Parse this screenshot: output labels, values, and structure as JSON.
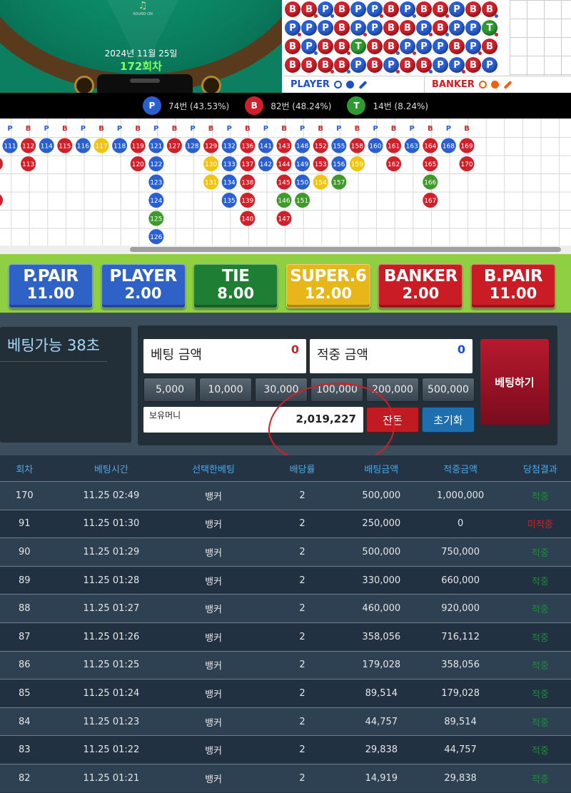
{
  "table": {
    "date": "2024년 11월 25일",
    "round": "172회차",
    "sound_label": "SOUND ON"
  },
  "bead_road": {
    "rows": [
      [
        "B",
        "B",
        "P",
        "B",
        "P",
        "P",
        "B",
        "P",
        "B",
        "B",
        "P",
        "B",
        "B"
      ],
      [
        "P",
        "P",
        "P",
        "B",
        "P",
        "P",
        "B",
        "B",
        "P",
        "B",
        "P",
        "P",
        "T"
      ],
      [
        "B",
        "P",
        "B",
        "B",
        "T",
        "B",
        "B",
        "P",
        "P",
        "P",
        "B",
        "P",
        "B"
      ],
      [
        "B",
        "B",
        "B",
        "B",
        "P",
        "B",
        "P",
        "B",
        "B",
        "P",
        "P",
        "B",
        "P"
      ]
    ]
  },
  "legend": {
    "player": "PLAYER",
    "banker": "BANKER"
  },
  "stats": [
    {
      "icon": "P",
      "text": "74번 (43.53%)",
      "color": "#2a5fd1"
    },
    {
      "icon": "B",
      "text": "82번 (48.24%)",
      "color": "#d0202a"
    },
    {
      "icon": "T",
      "text": "14번 (8.24%)",
      "color": "#2c9b30"
    }
  ],
  "big_road": {
    "headers": [
      "P",
      "B",
      "P",
      "B",
      "P",
      "B",
      "P",
      "B",
      "P",
      "B",
      "P",
      "B",
      "P",
      "B",
      "P",
      "B",
      "P",
      "B",
      "P",
      "B",
      "P",
      "B",
      "P",
      "B",
      "P",
      "B"
    ],
    "columns": [
      [
        [
          "111",
          "P"
        ]
      ],
      [
        [
          "112",
          "B"
        ],
        [
          "113",
          "B"
        ]
      ],
      [
        [
          "114",
          "P"
        ]
      ],
      [
        [
          "115",
          "B"
        ]
      ],
      [
        [
          "116",
          "P"
        ]
      ],
      [
        [
          "117",
          "T"
        ]
      ],
      [
        [
          "118",
          "P"
        ]
      ],
      [
        [
          "119",
          "B"
        ],
        [
          "120",
          "B"
        ]
      ],
      [
        [
          "121",
          "P"
        ],
        [
          "122",
          "P"
        ],
        [
          "123",
          "P"
        ],
        [
          "124",
          "P"
        ],
        [
          "125",
          "G"
        ],
        [
          "126",
          "P"
        ]
      ],
      [
        [
          "127",
          "B"
        ]
      ],
      [
        [
          "128",
          "P"
        ]
      ],
      [
        [
          "129",
          "B"
        ],
        [
          "130",
          "T"
        ],
        [
          "131",
          "T"
        ]
      ],
      [
        [
          "132",
          "P"
        ],
        [
          "133",
          "P"
        ],
        [
          "134",
          "P"
        ],
        [
          "135",
          "P"
        ]
      ],
      [
        [
          "136",
          "B"
        ],
        [
          "137",
          "B"
        ],
        [
          "138",
          "B"
        ],
        [
          "139",
          "B"
        ],
        [
          "140",
          "B"
        ]
      ],
      [
        [
          "141",
          "P"
        ],
        [
          "142",
          "P"
        ]
      ],
      [
        [
          "143",
          "B"
        ],
        [
          "144",
          "B"
        ],
        [
          "145",
          "B"
        ],
        [
          "146",
          "G"
        ],
        [
          "147",
          "B"
        ]
      ],
      [
        [
          "148",
          "P"
        ],
        [
          "149",
          "P"
        ],
        [
          "150",
          "P"
        ],
        [
          "151",
          "G"
        ]
      ],
      [
        [
          "152",
          "B"
        ],
        [
          "153",
          "B"
        ],
        [
          "154",
          "T"
        ]
      ],
      [
        [
          "155",
          "P"
        ],
        [
          "156",
          "P"
        ],
        [
          "157",
          "G"
        ]
      ],
      [
        [
          "158",
          "B"
        ],
        [
          "159",
          "T"
        ]
      ],
      [
        [
          "160",
          "P"
        ]
      ],
      [
        [
          "161",
          "B"
        ],
        [
          "162",
          "B"
        ]
      ],
      [
        [
          "163",
          "P"
        ]
      ],
      [
        [
          "164",
          "B"
        ],
        [
          "165",
          "B"
        ],
        [
          "166",
          "G"
        ],
        [
          "167",
          "B"
        ]
      ],
      [
        [
          "168",
          "P"
        ]
      ],
      [
        [
          "169",
          "B"
        ],
        [
          "170",
          "B"
        ]
      ]
    ],
    "partial_left": [
      "",
      "B",
      "",
      "B",
      "",
      ""
    ]
  },
  "bets": [
    {
      "name": "P.PAIR",
      "odds": "11.00",
      "color": "#2f62c6"
    },
    {
      "name": "PLAYER",
      "odds": "2.00",
      "color": "#2f62c6"
    },
    {
      "name": "TIE",
      "odds": "8.00",
      "color": "#1d7e34"
    },
    {
      "name": "SUPER.6",
      "odds": "12.00",
      "color": "#e7b619"
    },
    {
      "name": "BANKER",
      "odds": "2.00",
      "color": "#c91c24"
    },
    {
      "name": "B.PAIR",
      "odds": "11.00",
      "color": "#c91c24"
    }
  ],
  "panel": {
    "countdown": "베팅가능 38초",
    "bet_amount_label": "베팅 금액",
    "bet_amount_value": "0",
    "win_amount_label": "적중 금액",
    "win_amount_value": "0",
    "chips": [
      "5,000",
      "10,000",
      "30,000",
      "100,000",
      "200,000",
      "500,000"
    ],
    "balance_label": "보유머니",
    "balance_value": "2,019,227",
    "change_label": "잔돈",
    "reset_label": "초기화",
    "submit_label": "베팅하기"
  },
  "history": {
    "headers": [
      "회차",
      "베팅시간",
      "선택한베팅",
      "배당률",
      "배팅금액",
      "적중금액",
      "당첨결과"
    ],
    "rows": [
      [
        "170",
        "11.25 02:49",
        "뱅커",
        "2",
        "500,000",
        "1,000,000",
        "적중"
      ],
      [
        "91",
        "11.25 01:30",
        "뱅커",
        "2",
        "250,000",
        "0",
        "미적중"
      ],
      [
        "90",
        "11.25 01:29",
        "뱅커",
        "2",
        "500,000",
        "750,000",
        "적중"
      ],
      [
        "89",
        "11.25 01:28",
        "뱅커",
        "2",
        "330,000",
        "660,000",
        "적중"
      ],
      [
        "88",
        "11.25 01:27",
        "뱅커",
        "2",
        "460,000",
        "920,000",
        "적중"
      ],
      [
        "87",
        "11.25 01:26",
        "뱅커",
        "2",
        "358,056",
        "716,112",
        "적중"
      ],
      [
        "86",
        "11.25 01:25",
        "뱅커",
        "2",
        "179,028",
        "358,056",
        "적중"
      ],
      [
        "85",
        "11.25 01:24",
        "뱅커",
        "2",
        "89,514",
        "179,028",
        "적중"
      ],
      [
        "84",
        "11.25 01:23",
        "뱅커",
        "2",
        "44,757",
        "89,514",
        "적중"
      ],
      [
        "83",
        "11.25 01:22",
        "뱅커",
        "2",
        "29,838",
        "44,757",
        "적중"
      ],
      [
        "82",
        "11.25 01:21",
        "뱅커",
        "2",
        "14,919",
        "29,838",
        "적중"
      ]
    ]
  }
}
